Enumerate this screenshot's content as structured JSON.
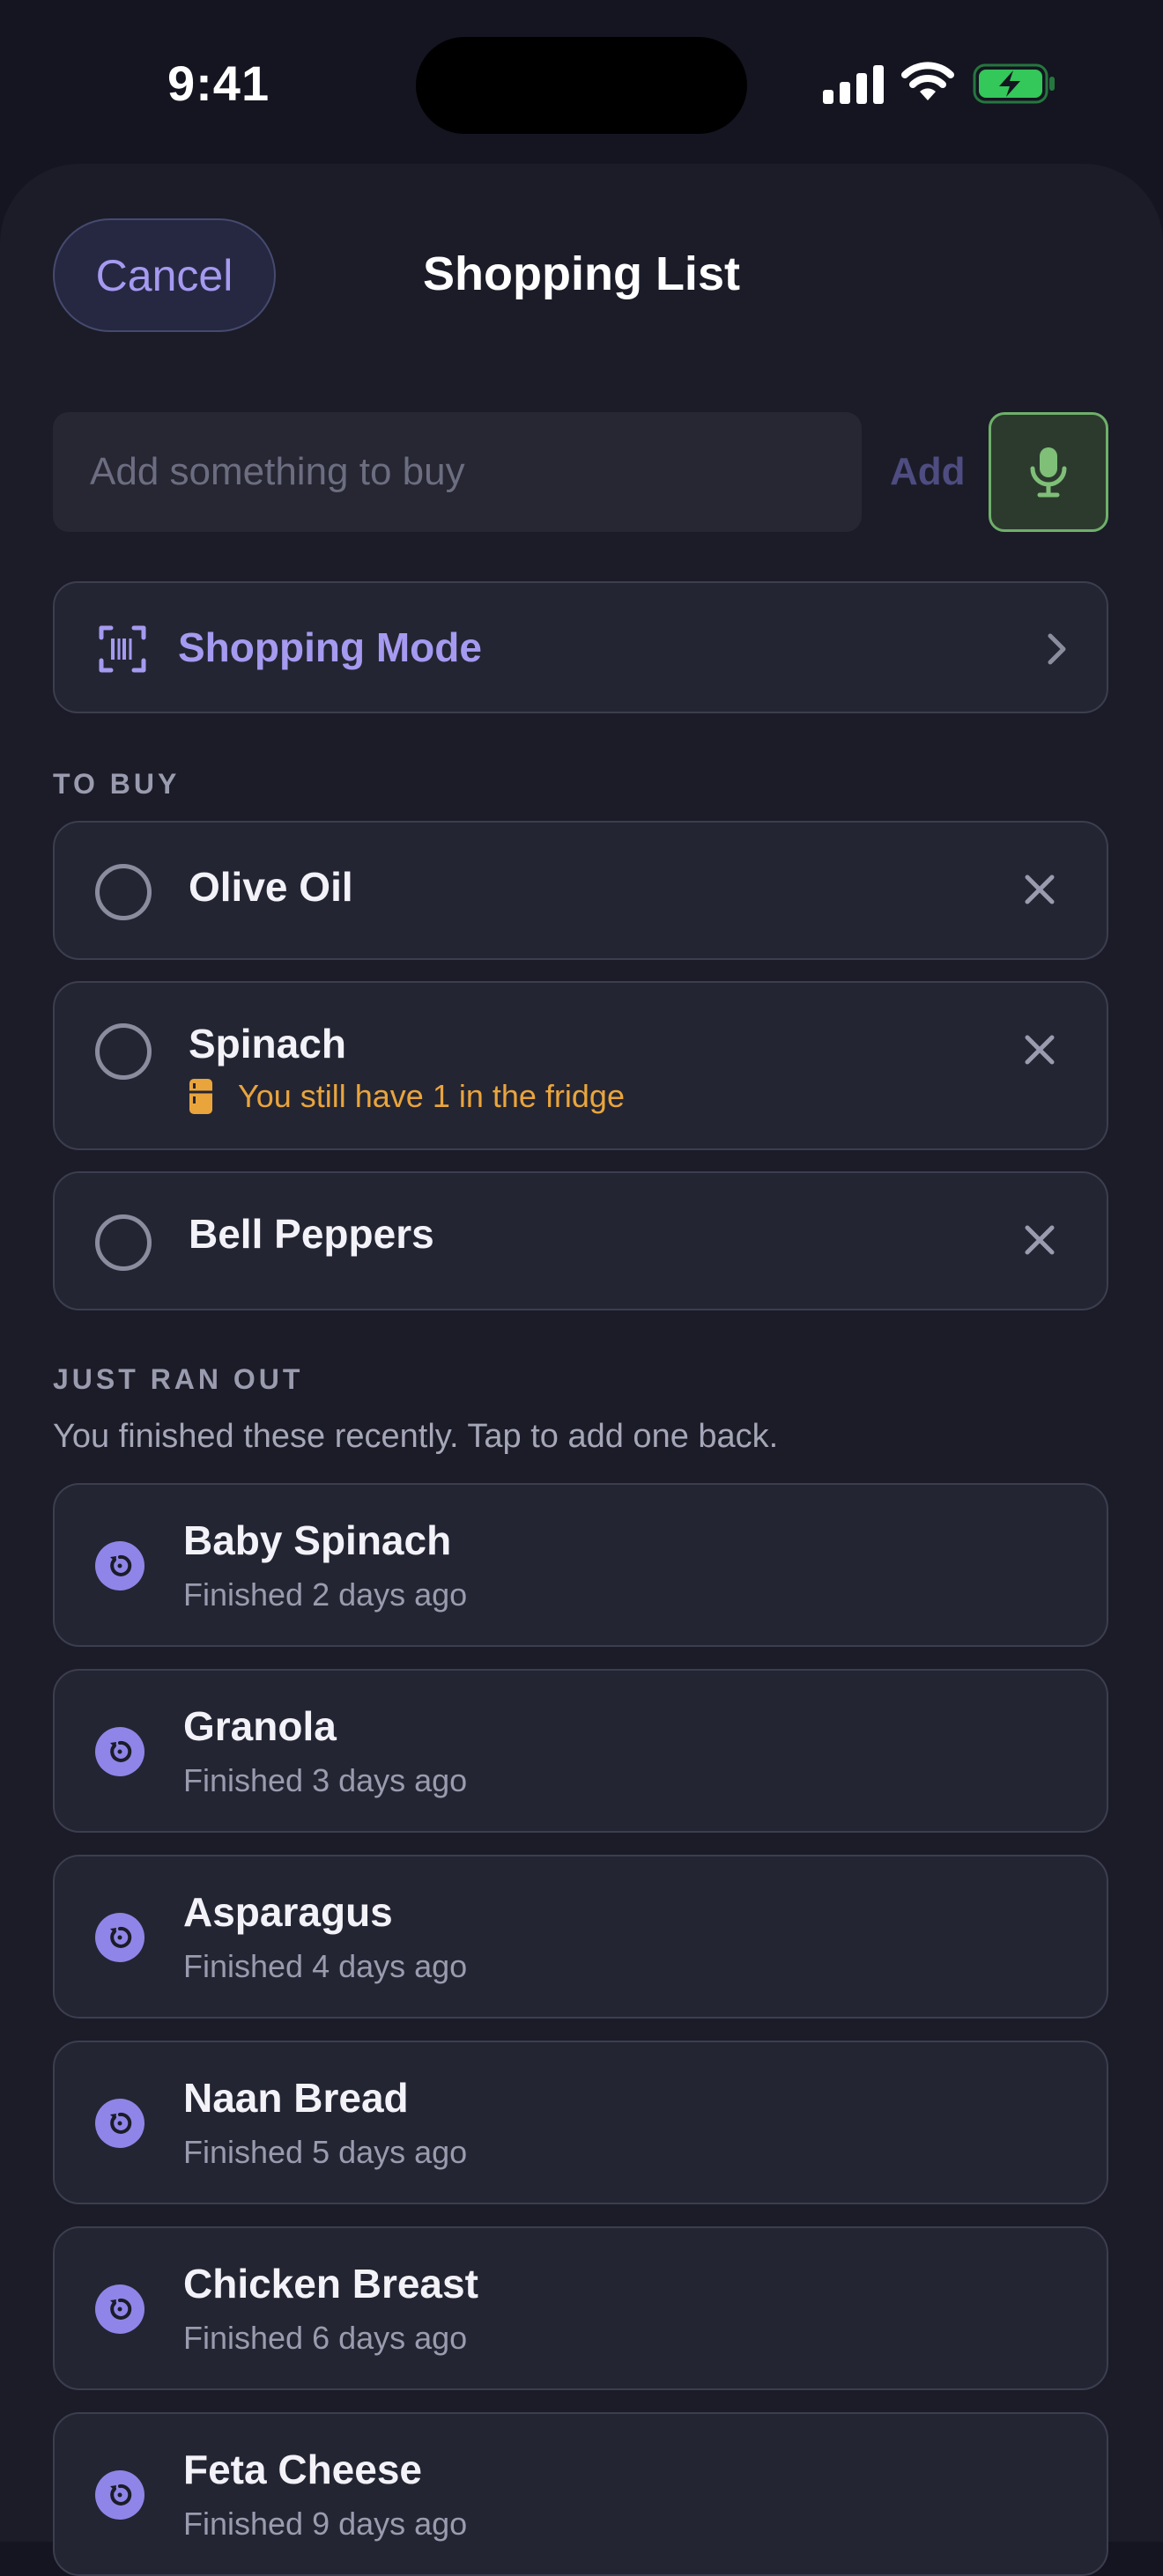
{
  "status_bar": {
    "time": "9:41"
  },
  "sheet": {
    "cancel_label": "Cancel",
    "title": "Shopping List"
  },
  "add_bar": {
    "placeholder": "Add something to buy",
    "add_label": "Add",
    "mic_icon": "microphone-icon"
  },
  "shopping_mode": {
    "label": "Shopping Mode",
    "icon": "barcode-scan-icon"
  },
  "to_buy": {
    "heading": "TO BUY",
    "items": [
      {
        "name": "Olive Oil",
        "note": ""
      },
      {
        "name": "Spinach",
        "note": "You still have 1 in the fridge"
      },
      {
        "name": "Bell Peppers",
        "note": ""
      }
    ]
  },
  "ran_out": {
    "heading": "JUST RAN OUT",
    "hint": "You finished these recently. Tap to add one back.",
    "items": [
      {
        "name": "Baby Spinach",
        "finished": "Finished 2 days ago"
      },
      {
        "name": "Granola",
        "finished": "Finished 3 days ago"
      },
      {
        "name": "Asparagus",
        "finished": "Finished 4 days ago"
      },
      {
        "name": "Naan Bread",
        "finished": "Finished 5 days ago"
      },
      {
        "name": "Chicken Breast",
        "finished": "Finished 6 days ago"
      },
      {
        "name": "Feta Cheese",
        "finished": "Finished 9 days ago"
      }
    ]
  },
  "colors": {
    "background": "#141520",
    "card": "#242533",
    "accent": "#A59AF0",
    "warning": "#E9A53C",
    "mic_green": "#6FAF6A",
    "battery_green": "#34C759"
  }
}
